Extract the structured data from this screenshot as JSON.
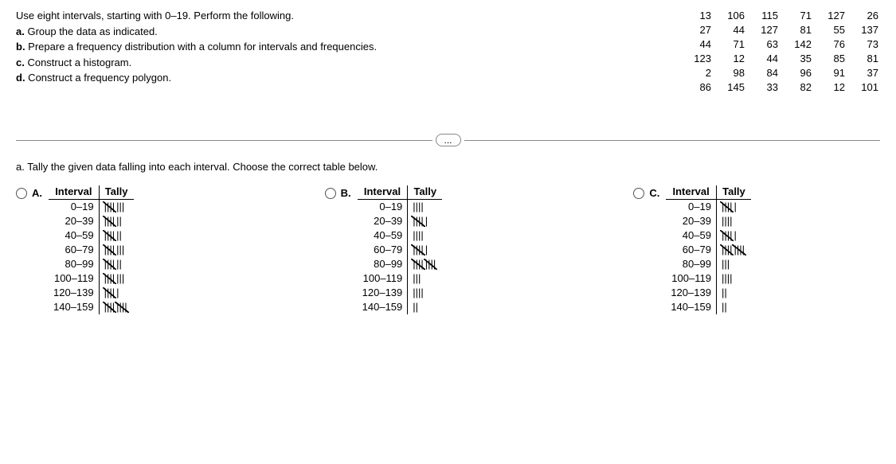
{
  "instructions": {
    "intro": "Use eight intervals, starting with 0–19. Perform the following.",
    "a": "a.",
    "a_text": " Group the data as indicated.",
    "b": "b.",
    "b_text": " Prepare a frequency distribution with a column for intervals and frequencies.",
    "c": "c.",
    "c_text": " Construct a histogram.",
    "d": "d.",
    "d_text": " Construct a frequency polygon."
  },
  "data_values": [
    [
      "13",
      "106",
      "115",
      "71",
      "127",
      "26"
    ],
    [
      "27",
      "44",
      "127",
      "81",
      "55",
      "137"
    ],
    [
      "44",
      "71",
      "63",
      "142",
      "76",
      "73"
    ],
    [
      "123",
      "12",
      "44",
      "35",
      "85",
      "81"
    ],
    [
      "2",
      "98",
      "84",
      "96",
      "91",
      "37"
    ],
    [
      "86",
      "145",
      "33",
      "82",
      "12",
      "101"
    ]
  ],
  "dots": "...",
  "prompt": {
    "label": "a.",
    "text": " Tally the given data falling into each interval. Choose the correct table below."
  },
  "headers": {
    "interval": "Interval",
    "tally": "Tally"
  },
  "option_labels": {
    "A": "A.",
    "B": "B.",
    "C": "C."
  },
  "intervals": [
    "0–19",
    "20–39",
    "40–59",
    "60–79",
    "80–99",
    "100–119",
    "120–139",
    "140–159"
  ],
  "tally_A": [
    8,
    7,
    7,
    8,
    7,
    8,
    6,
    10
  ],
  "tally_B": [
    4,
    6,
    4,
    6,
    10,
    3,
    4,
    2
  ],
  "tally_C": [
    6,
    4,
    6,
    10,
    3,
    4,
    2,
    2
  ]
}
